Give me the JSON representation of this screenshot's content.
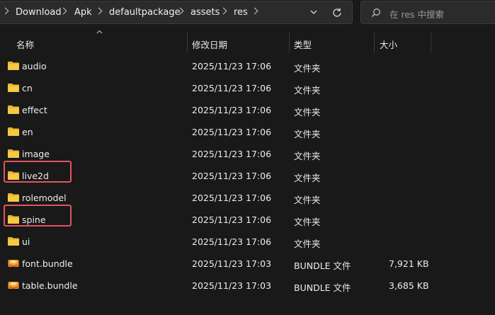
{
  "breadcrumb": [
    "Download",
    "Apk",
    "defaultpackage",
    "assets",
    "res"
  ],
  "search": {
    "placeholder": "在 res 中搜索"
  },
  "columns": {
    "name": "名称",
    "date": "修改日期",
    "type": "类型",
    "size": "大小"
  },
  "files": [
    {
      "name": "audio",
      "date": "2025/11/23 17:06",
      "type": "文件夹",
      "size": "",
      "icon": "folder-icon"
    },
    {
      "name": "cn",
      "date": "2025/11/23 17:06",
      "type": "文件夹",
      "size": "",
      "icon": "folder-icon"
    },
    {
      "name": "effect",
      "date": "2025/11/23 17:06",
      "type": "文件夹",
      "size": "",
      "icon": "folder-icon"
    },
    {
      "name": "en",
      "date": "2025/11/23 17:06",
      "type": "文件夹",
      "size": "",
      "icon": "folder-icon"
    },
    {
      "name": "image",
      "date": "2025/11/23 17:06",
      "type": "文件夹",
      "size": "",
      "icon": "folder-icon"
    },
    {
      "name": "live2d",
      "date": "2025/11/23 17:06",
      "type": "文件夹",
      "size": "",
      "icon": "folder-icon",
      "highlighted": true
    },
    {
      "name": "rolemodel",
      "date": "2025/11/23 17:06",
      "type": "文件夹",
      "size": "",
      "icon": "folder-icon"
    },
    {
      "name": "spine",
      "date": "2025/11/23 17:06",
      "type": "文件夹",
      "size": "",
      "icon": "folder-icon",
      "highlighted": true
    },
    {
      "name": "ui",
      "date": "2025/11/23 17:06",
      "type": "文件夹",
      "size": "",
      "icon": "folder-icon"
    },
    {
      "name": "font.bundle",
      "date": "2025/11/23 17:03",
      "type": "BUNDLE 文件",
      "size": "7,921 KB",
      "icon": "bundle-file-icon"
    },
    {
      "name": "table.bundle",
      "date": "2025/11/23 17:03",
      "type": "BUNDLE 文件",
      "size": "3,685 KB",
      "icon": "bundle-file-icon"
    }
  ],
  "colors": {
    "highlight": "#e05561",
    "folder": "#f3c13a",
    "background": "#191919"
  }
}
